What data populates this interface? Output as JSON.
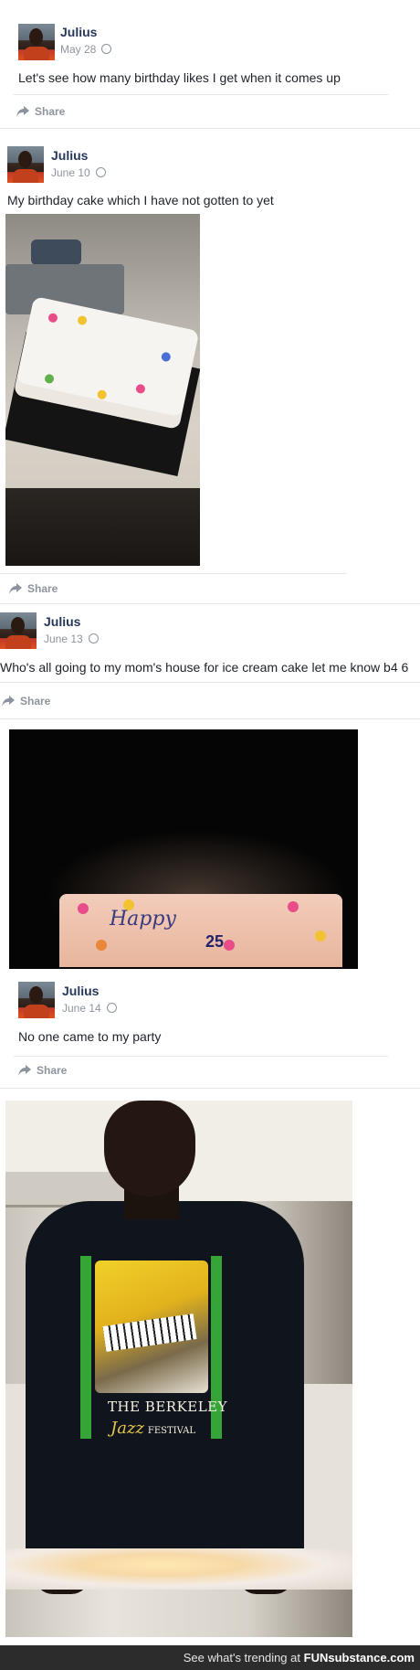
{
  "posts": [
    {
      "name": "Julius",
      "date": "May 28",
      "text": "Let's see how many birthday likes I get when it comes up",
      "share": "Share"
    },
    {
      "name": "Julius",
      "date": "June 10",
      "text": "My birthday cake which I have not gotten to yet",
      "share": "Share"
    },
    {
      "name": "Julius",
      "date": "June 13",
      "text": "Who's all going to my mom's house for ice cream cake let me know b4 6",
      "share": "Share"
    },
    {
      "name": "Julius",
      "date": "June 14",
      "text": "No one came to my party",
      "share": "Share"
    }
  ],
  "cake_writing": "Happy",
  "cake_number": "25",
  "shirt_text": {
    "line1": "THE BERKELEY",
    "line2": "Jazz",
    "line3": "FESTIVAL"
  },
  "footer": {
    "prefix": "See what's trending at",
    "brand": "FUNsubstance.com"
  },
  "colors": {
    "name": "#27375c",
    "meta": "#8d949e",
    "footer_bg": "#2c2c2c"
  }
}
